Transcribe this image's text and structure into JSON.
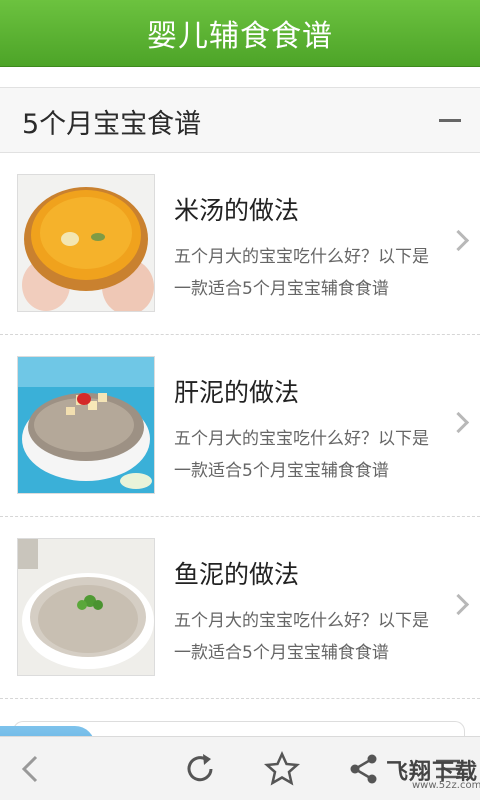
{
  "app": {
    "title": "婴儿辅食食谱"
  },
  "section": {
    "title": "5个月宝宝食谱"
  },
  "recipes": [
    {
      "title": "米汤的做法",
      "description": "五个月大的宝宝吃什么好？以下是一款适合5个月宝宝辅食食谱"
    },
    {
      "title": "肝泥的做法",
      "description": "五个月大的宝宝吃什么好？以下是一款适合5个月宝宝辅食食谱"
    },
    {
      "title": "鱼泥的做法",
      "description": "五个月大的宝宝吃什么好？以下是一款适合5个月宝宝辅食食谱"
    }
  ],
  "toolbar": {
    "icons": [
      "back-icon",
      "refresh-icon",
      "star-icon",
      "share-icon",
      "menu-icon"
    ]
  },
  "watermark": {
    "main": "飞翔下载",
    "url": "www.52z.com"
  },
  "colors": {
    "title_bar": "#5cb832",
    "section_bg": "#f7f7f7",
    "text_primary": "#222222",
    "text_secondary": "#666666"
  }
}
